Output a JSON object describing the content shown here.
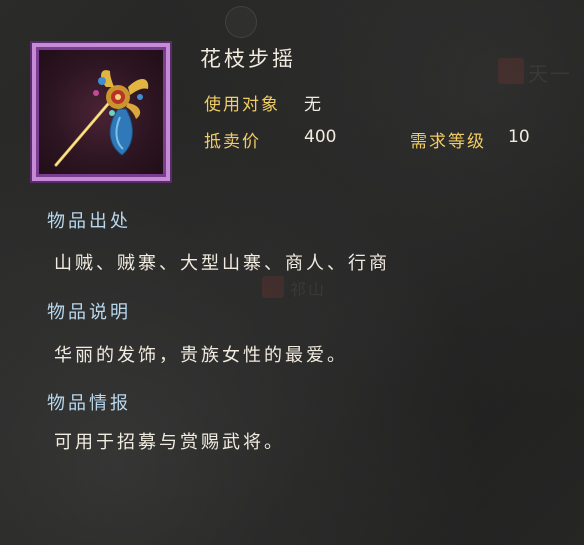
{
  "item": {
    "name": "花枝步摇",
    "target_label": "使用对象",
    "target_value": "无",
    "price_label": "抵卖价",
    "price_value": "400",
    "level_label": "需求等级",
    "level_value": "10",
    "rarity_color": "#c68bd6"
  },
  "sections": {
    "source_title": "物品出处",
    "source_text": "山贼、贼寨、大型山寨、商人、行商",
    "desc_title": "物品说明",
    "desc_text": "华丽的发饰，贵族女性的最爱。",
    "info_title": "物品情报",
    "info_text": "可用于招募与赏赐武将。"
  },
  "background": {
    "mark_top_right": "天一",
    "mark_middle": "祁山"
  },
  "colors": {
    "label": "#f0cd64",
    "value": "#f1ebe0",
    "section_title": "#b9d8ee"
  }
}
